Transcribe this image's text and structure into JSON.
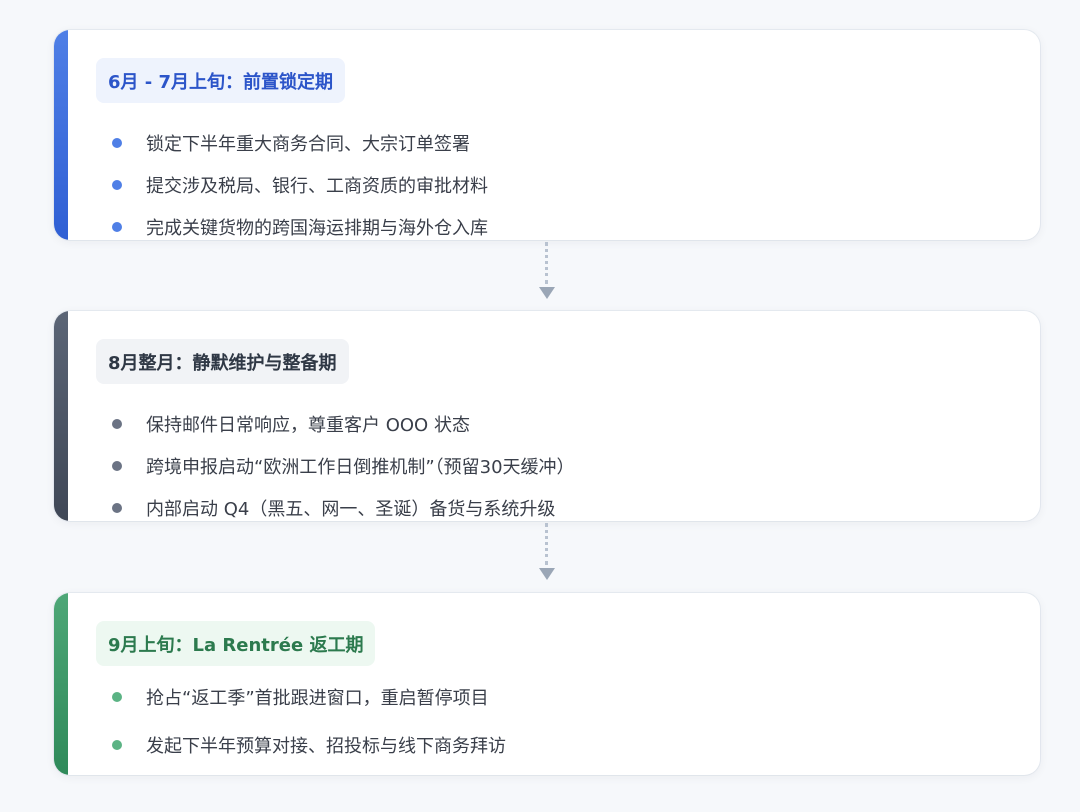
{
  "phases": [
    {
      "title": "6月 - 7月上旬：前置锁定期",
      "accent": "#3b6ae0",
      "items": [
        "锁定下半年重大商务合同、大宗订单签署",
        "提交涉及税局、银行、工商资质的审批材料",
        "完成关键货物的跨国海运排期与海外仓入库"
      ]
    },
    {
      "title": "8月整月：静默维护与整备期",
      "accent": "#4a5363",
      "items": [
        "保持邮件日常响应，尊重客户 OOO 状态",
        "跨境申报启动“欧洲工作日倒推机制”（预留30天缓冲）",
        "内部启动 Q4（黑五、网一、圣诞）备货与系统升级"
      ]
    },
    {
      "title": "9月上旬：La Rentrée 返工期",
      "accent": "#3a9566",
      "items": [
        "抢占“返工季”首批跟进窗口，重启暂停项目",
        "发起下半年预算对接、招投标与线下商务拜访"
      ]
    }
  ]
}
